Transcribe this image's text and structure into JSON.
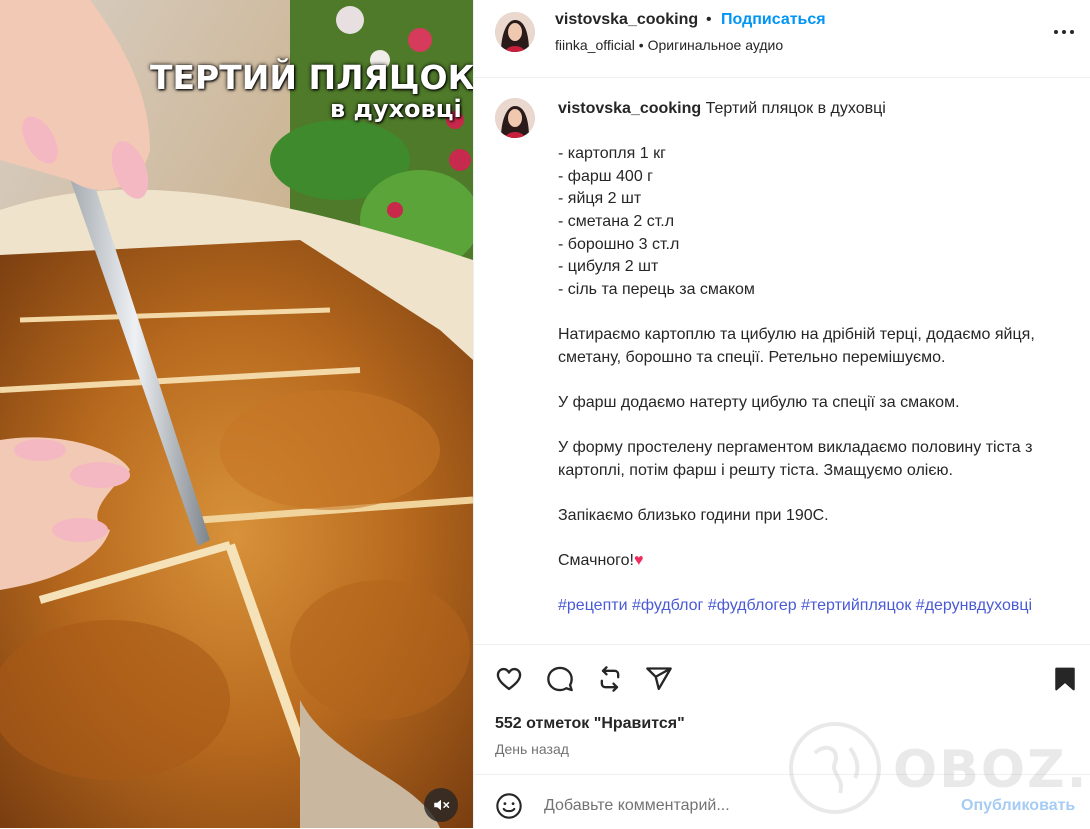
{
  "media": {
    "overlay_title": "ТЕРТИЙ ПЛЯЦОК",
    "overlay_subtitle": "в духовці",
    "mute_icon": "speaker-muted-icon"
  },
  "header": {
    "username": "vistovska_cooking",
    "separator": "•",
    "follow_label": "Подписаться",
    "audio_author": "fiinka_official",
    "audio_label": "Оригинальное аудио",
    "more_icon": "more-horizontal-icon"
  },
  "caption": {
    "username": "vistovska_cooking",
    "title": "Тертий пляцок в духовці",
    "ingredients": [
      "- картопля 1 кг",
      "- фарш 400 г",
      "- яйця 2 шт",
      "- сметана 2 ст.л",
      "- борошно 3 ст.л",
      "- цибуля 2 шт",
      "- сіль та перець за смаком"
    ],
    "step1": "Натираємо картоплю та цибулю на дрібній терці, додаємо яйця, сметану, борошно та спеції. Ретельно перемішуємо.",
    "step2": "У фарш додаємо натерту цибулю та спеції за смаком.",
    "step3": "У форму простелену пергаментом викладаємо половину тіста з картоплі, потім фарш і решту тіста. Змащуємо олією.",
    "step4": "Запікаємо близько години при 190С.",
    "closing": "Смачного!",
    "closing_emoji": "♥",
    "hashtags": [
      "#рецепти",
      "#фудблог",
      "#фудблогер",
      "#тертийпляцок",
      "#дерунвдуховці"
    ]
  },
  "actions": {
    "like_icon": "heart-icon",
    "comment_icon": "comment-icon",
    "repost_icon": "repost-icon",
    "share_icon": "share-icon",
    "save_icon": "bookmark-icon",
    "likes_text": "552 отметок \"Нравится\"",
    "time_text": "День назад"
  },
  "comment": {
    "emoji_icon": "emoji-icon",
    "placeholder": "Добавьте комментарий...",
    "publish_label": "Опубликовать"
  },
  "watermark": {
    "text": "OBOZ.UA"
  },
  "colors": {
    "link_blue": "#0095f6",
    "hashtag": "#4a5ad4",
    "publish_disabled": "#a7ccf4",
    "text": "#262626",
    "muted": "#737373"
  }
}
